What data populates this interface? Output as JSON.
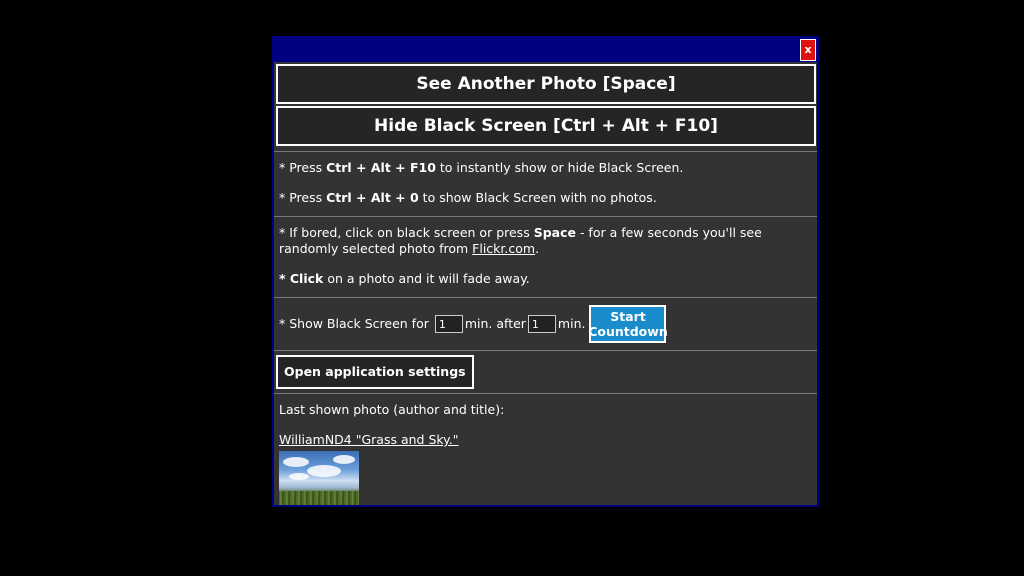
{
  "dialog": {
    "close_label": "x"
  },
  "buttons": {
    "see_another": "See Another Photo [Space]",
    "hide_black": "Hide Black Screen [Ctrl + Alt + F10]",
    "start_line1": "Start",
    "start_line2": "Countdown",
    "open_settings": "Open application settings"
  },
  "hints": {
    "line1_prefix": "* Press ",
    "line1_keys": "Ctrl + Alt + F10",
    "line1_suffix": " to instantly show or hide Black Screen.",
    "line2_prefix": "* Press ",
    "line2_keys": "Ctrl + Alt + 0",
    "line2_suffix": " to show Black Screen with no photos.",
    "line3_prefix": "* If bored, click on black screen or press ",
    "line3_key": "Space",
    "line3_suffix": " - for a few seconds you'll see randomly selected photo from ",
    "line3_link": "Flickr.com",
    "line3_end": ".",
    "line4_bold": "* Click",
    "line4_suffix": " on a photo and it will fade away."
  },
  "countdown": {
    "label_prefix": "* Show Black Screen for ",
    "minutes_value": "1",
    "label_middle": "min. after",
    "after_value": "1",
    "label_suffix": "min."
  },
  "last_photo": {
    "label": "Last shown photo (author and title):",
    "link": "WilliamND4 \"Grass and Sky.\""
  }
}
